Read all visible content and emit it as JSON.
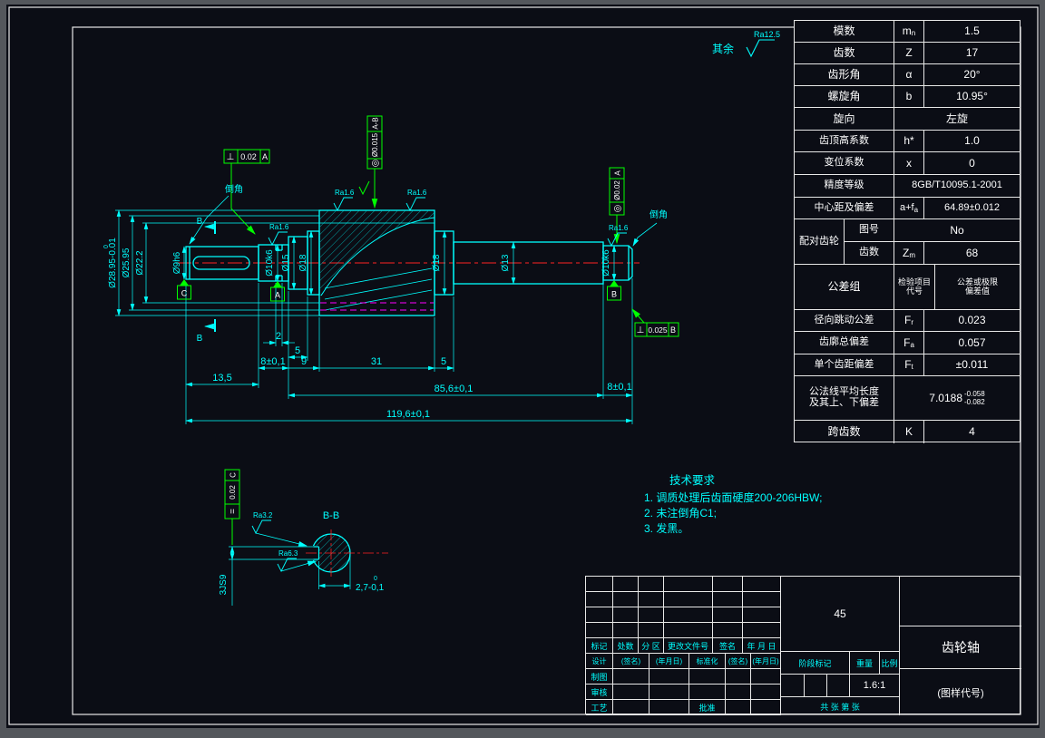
{
  "colors": {
    "bg": "#0b0d15",
    "line_cyan": "#00ffff",
    "line_green": "#00ff00",
    "line_red": "#ff2222",
    "line_magenta": "#ff00ff",
    "frame_white": "#e8e8e8",
    "text_white": "#ffffff"
  },
  "pt": {
    "r0l": "模数",
    "r0s": "m",
    "r0ss": "n",
    "r0v": "1.5",
    "r1l": "齿数",
    "r1s": "Z",
    "r1v": "17",
    "r2l": "齿形角",
    "r2s": "α",
    "r2v": "20°",
    "r3l": "螺旋角",
    "r3s": "b",
    "r3v": "10.95°",
    "r4l": "旋向",
    "r4v": "左旋",
    "r5l": "齿顶高系数",
    "r5s": "h*",
    "r5v": "1.0",
    "r6l": "变位系数",
    "r6s": "x",
    "r6v": "0",
    "r7l": "精度等级",
    "r7v": "8GB/T10095.1-2001",
    "r8l": "中心距及偏差",
    "r8s": "a+f",
    "r8ss": "a",
    "r8v": "64.89±0.012",
    "r9l": "配对齿轮",
    "r9a": "图号",
    "r9av": "No",
    "r9b": "齿数",
    "r9bs": "Z",
    "r9bss": "m",
    "r9bv": "68",
    "r10l": "公差组",
    "r10m1": "检验项目",
    "r10m2": "代号",
    "r10v1": "公差或极限",
    "r10v2": "偏差值",
    "r11l": "径向跳动公差",
    "r11s": "F",
    "r11ss": "r",
    "r11v": "0.023",
    "r12l": "齿廓总偏差",
    "r12s": "F",
    "r12ss": "a",
    "r12v": "0.057",
    "r13l": "单个齿距偏差",
    "r13s": "F",
    "r13ss": "t",
    "r13v": "±0.011",
    "r14l1": "公法线平均长度",
    "r14l2": "及其上、下偏差",
    "r14v": "7.0188",
    "r14sup": "-0.058",
    "r14sub": "-0.082",
    "r15l": "跨齿数",
    "r15s": "K",
    "r15v": "4"
  },
  "dims": {
    "tip_dia": "Ø28.95-0.01",
    "tip_sup": "0",
    "pitch_dia": "Ø25.95",
    "root_dia": "Ø22.2",
    "d9": "Ø9h6",
    "d10_left": "Ø10k6",
    "d15": "Ø15",
    "d18_left": "Ø18",
    "d18_right": "Ø18",
    "d13": "Ø13",
    "d10_right": "Ø10k6",
    "groove": "2",
    "len5_left": "5",
    "len8_left": "8±0,1",
    "len9": "9",
    "len31": "31",
    "len5_right": "5",
    "len13_5": "13,5",
    "len85_6": "85,6±0,1",
    "len8_right": "8±0,1",
    "total": "119,6±0,1"
  },
  "gdt": {
    "f1_sym": "⊥",
    "f1_tol": "0.02",
    "f1_dat": "A",
    "f2_sym": "◎",
    "f2_tol": "Ø0.015",
    "f2_dat": "A-B",
    "f3_sym": "◎",
    "f3_tol": "Ø0.02",
    "f3_dat": "A",
    "f4_sym": "⊥",
    "f4_tol": "0.025",
    "f4_dat": "B",
    "f5_sym": "=",
    "f5_tol": "0.02",
    "f5_dat": "C",
    "dat_a": "A",
    "dat_b": "B",
    "dat_c": "C"
  },
  "marks": {
    "rest": "其余",
    "ra125": "Ra12.5",
    "ra16": "Ra1.6",
    "ra32": "Ra3.2",
    "ra63": "Ra6.3",
    "chamfer": "倒角",
    "section_b": "B",
    "section_label": "B-B",
    "kw_width": "3JS9",
    "kw_depth": "2,7-0,1",
    "kw_depth_sup": "0"
  },
  "tech": {
    "title": "技术要求",
    "i1": "1. 调质处理后齿面硬度200-206HBW;",
    "i2": "2. 未注倒角C1;",
    "i3": "3. 发黑。"
  },
  "tb": {
    "h1": "标记",
    "h2": "处数",
    "h3": "分 区",
    "h4": "更改文件号",
    "h5": "签名",
    "h6": "年 月 日",
    "design": "设计",
    "sign": "(签名)",
    "date": "(年月日)",
    "std": "标准化",
    "draft": "制图",
    "check": "审核",
    "proc": "工艺",
    "appr": "批准",
    "mat": "45",
    "stage": "阶段标记",
    "weight": "重量",
    "scale_label": "比例",
    "scale": "1.6:1",
    "sheets": "共 张 第 张",
    "part": "齿轮轴",
    "code": "(图样代号)"
  }
}
